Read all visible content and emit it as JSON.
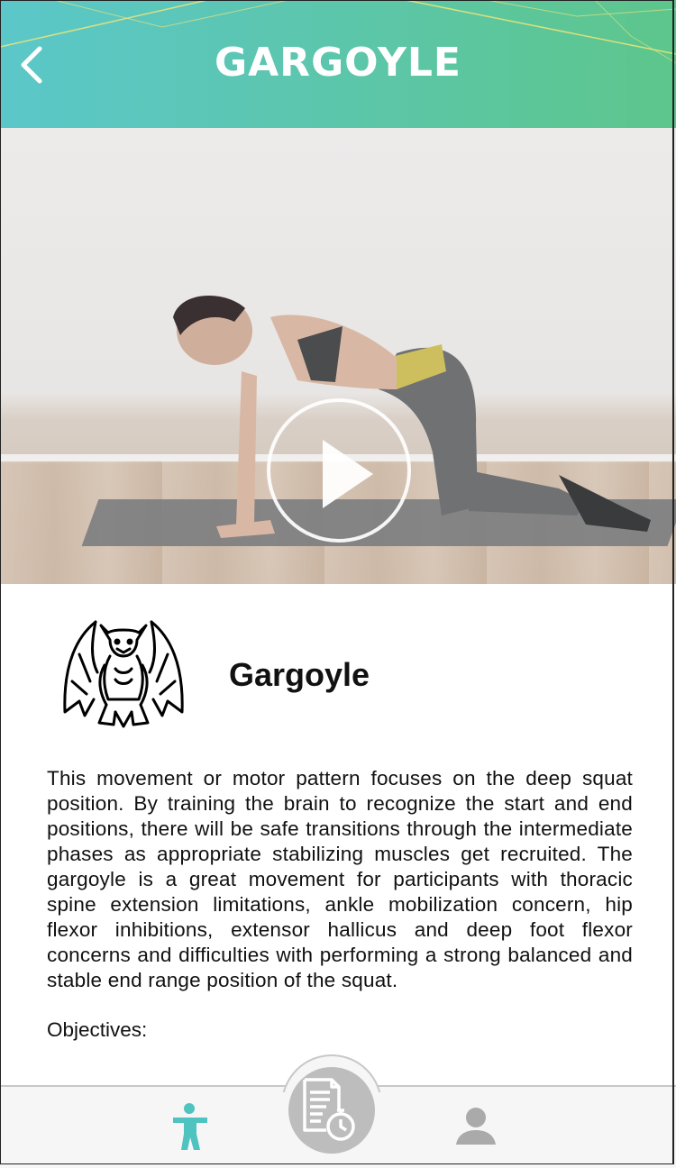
{
  "header": {
    "title": "GARGOYLE",
    "back_icon": "chevron-left-icon",
    "gradient_colors": [
      "#5bc7c9",
      "#5dc68c"
    ]
  },
  "video": {
    "play_icon": "play-icon"
  },
  "exercise": {
    "icon": "gargoyle-icon",
    "name": "Gargoyle",
    "description": "This movement or motor pattern focuses on the deep squat position. By training the brain to recognize the start and end positions, there will be safe transitions through the intermediate phases as appropriate stabilizing muscles get recruited. The gargoyle is a great movement for participants with thoracic spine extension limitations, ankle mobilization concern, hip flexor inhibitions, extensor hallicus and deep foot flexor concerns and difficulties with performing a strong balanced and stable end range position of the squat.",
    "objectives_label": "Objectives:"
  },
  "nav": {
    "items": [
      {
        "icon": "person-exercise-icon",
        "active": true,
        "color": "#4fc3c0"
      },
      {
        "icon": "workout-log-timer-icon",
        "active": false,
        "color": "#ffffff"
      },
      {
        "icon": "profile-icon",
        "active": false,
        "color": "#aaaaaa"
      }
    ]
  }
}
